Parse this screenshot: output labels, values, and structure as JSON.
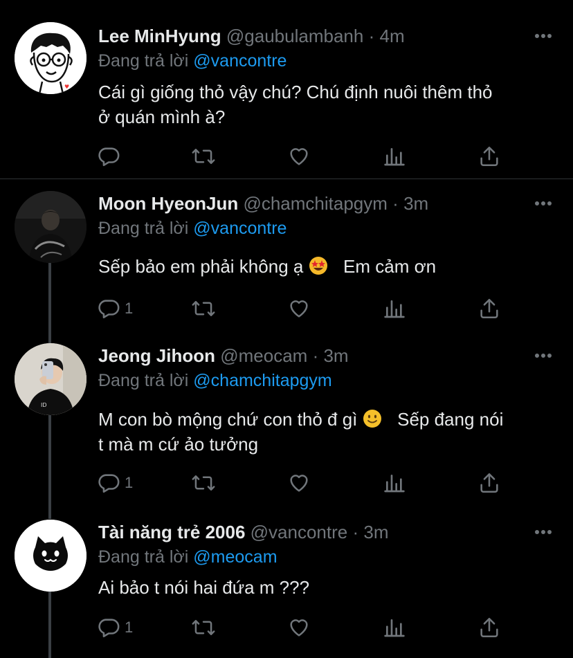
{
  "tweets": [
    {
      "name": "Lee MinHyung",
      "handle": "@gaubulambanh",
      "separator": "·",
      "time": "4m",
      "reply_prefix": "Đang trả lời",
      "reply_to": "@vancontre",
      "text_line1": "Cái gì giống thỏ vậy chú? Chú định nuôi thêm thỏ",
      "text_line2": "ở quán mình à?",
      "reply_count": ""
    },
    {
      "name": "Moon HyeonJun",
      "handle": "@chamchitapgym",
      "separator": "·",
      "time": "3m",
      "reply_prefix": "Đang trả lời",
      "reply_to": "@vancontre",
      "text_a": "Sếp bảo em phải không ạ",
      "emoji": "star-struck-emoji",
      "text_b": "Em cảm ơn",
      "reply_count": "1"
    },
    {
      "name": "Jeong Jihoon",
      "handle": "@meocam",
      "separator": "·",
      "time": "3m",
      "reply_prefix": "Đang trả lời",
      "reply_to": "@chamchitapgym",
      "text_a": "M con bò mộng chứ con thỏ đ gì",
      "emoji": "slightly-smiling-emoji",
      "text_b": "Sếp đang nói",
      "text_line2": "t mà m cứ ảo tưởng",
      "reply_count": "1"
    },
    {
      "name": "Tài năng trẻ 2006",
      "handle": "@vancontre",
      "separator": "·",
      "time": "3m",
      "reply_prefix": "Đang trả lời",
      "reply_to": "@meocam",
      "text_line1": "Ai bảo t nói hai đứa m ???",
      "reply_count": "1"
    }
  ],
  "colors": {
    "background": "#000000",
    "text": "#e7e9ea",
    "muted": "#71767b",
    "link": "#1d9bf0",
    "divider": "#2f3336"
  },
  "icons": [
    "reply-icon",
    "retweet-icon",
    "like-icon",
    "analytics-icon",
    "share-icon",
    "more-icon"
  ]
}
